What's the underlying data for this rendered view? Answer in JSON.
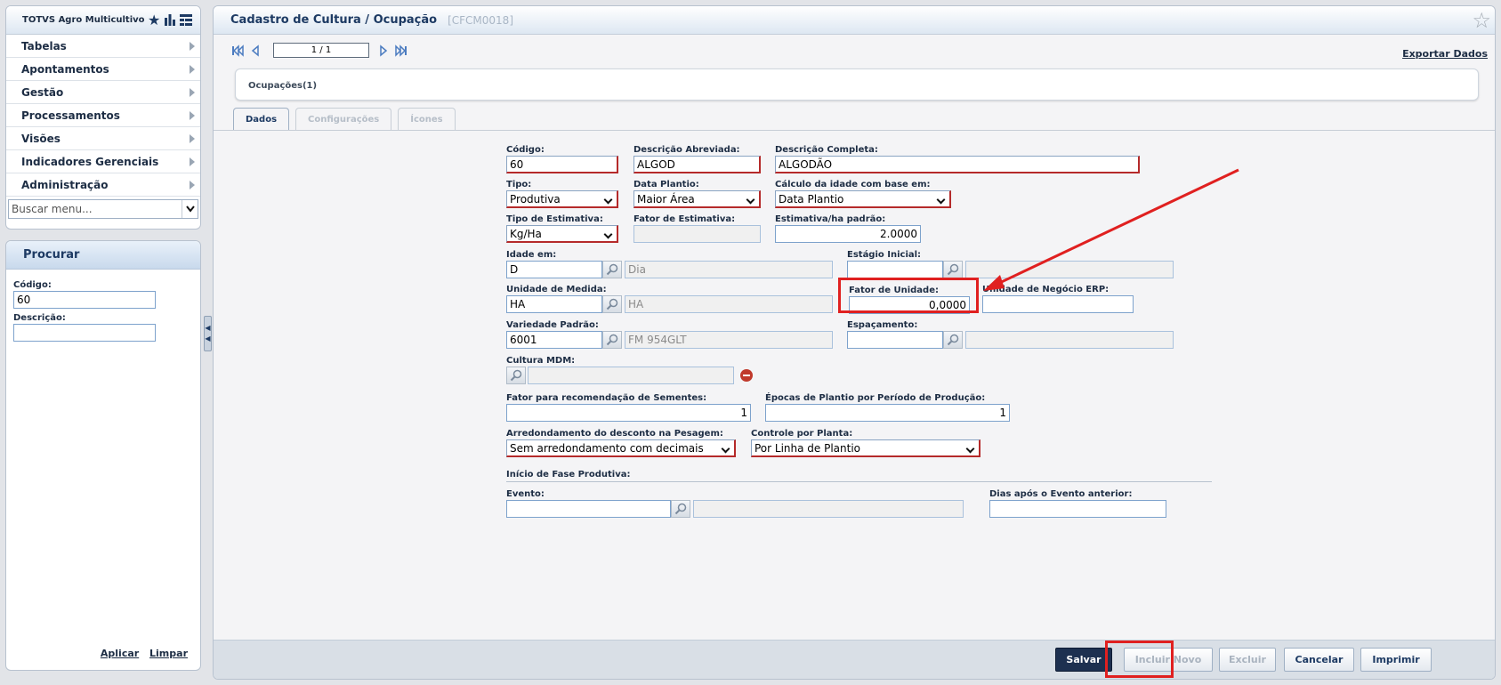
{
  "sidebar": {
    "app_title": "TOTVS Agro Multicultivo",
    "header_icons": [
      "star-icon",
      "bar-chart-icon",
      "grid-list-icon"
    ],
    "menu_items": [
      {
        "label": "Tabelas"
      },
      {
        "label": "Apontamentos"
      },
      {
        "label": "Gestão"
      },
      {
        "label": "Processamentos"
      },
      {
        "label": "Visões"
      },
      {
        "label": "Indicadores Gerenciais"
      },
      {
        "label": "Administração"
      }
    ],
    "menu_search_placeholder": "Buscar menu...",
    "search_panel": {
      "title": "Procurar",
      "codigo_label": "Código:",
      "codigo_value": "60",
      "descricao_label": "Descrição:",
      "descricao_value": "",
      "apply_label": "Aplicar",
      "clear_label": "Limpar"
    }
  },
  "header": {
    "title": "Cadastro de Cultura / Ocupação",
    "code": "[CFCM0018]"
  },
  "navigation": {
    "page_indicator": "1 / 1",
    "export_label": "Exportar Dados"
  },
  "occupations_label": "Ocupações(1)",
  "tabs": [
    {
      "label": "Dados",
      "active": true
    },
    {
      "label": "Configurações",
      "active": false
    },
    {
      "label": "Ícones",
      "active": false
    }
  ],
  "form": {
    "codigo": {
      "label": "Código:",
      "value": "60"
    },
    "descricao_abreviada": {
      "label": "Descrição Abreviada:",
      "value": "ALGOD"
    },
    "descricao_completa": {
      "label": "Descrição Completa:",
      "value": "ALGODÃO"
    },
    "tipo": {
      "label": "Tipo:",
      "value": "Produtiva"
    },
    "data_plantio": {
      "label": "Data Plantio:",
      "value": "Maior Área"
    },
    "calculo_idade": {
      "label": "Cálculo da idade com base em:",
      "value": "Data Plantio"
    },
    "tipo_estimativa": {
      "label": "Tipo de Estimativa:",
      "value": "Kg/Ha"
    },
    "fator_estimativa": {
      "label": "Fator de Estimativa:",
      "value": ""
    },
    "estimativa_ha": {
      "label": "Estimativa/ha padrão:",
      "value": "2.0000"
    },
    "idade_em": {
      "label": "Idade em:",
      "value": "D",
      "desc": "Dia"
    },
    "estagio_inicial": {
      "label": "Estágio Inicial:",
      "value": "",
      "desc": ""
    },
    "unidade_medida": {
      "label": "Unidade de Medida:",
      "value": "HA",
      "desc": "HA"
    },
    "fator_unidade": {
      "label": "Fator de Unidade:",
      "value": "0,0000"
    },
    "unidade_negocio": {
      "label": "Unidade de Negócio ERP:",
      "value": ""
    },
    "variedade_padrao": {
      "label": "Variedade Padrão:",
      "value": "6001",
      "desc": "FM 954GLT"
    },
    "espacamento": {
      "label": "Espaçamento:",
      "value": "",
      "desc": ""
    },
    "cultura_mdm": {
      "label": "Cultura MDM:",
      "desc": ""
    },
    "fator_sementes": {
      "label": "Fator para recomendação de Sementes:",
      "value": "1"
    },
    "epocas_plantio": {
      "label": "Épocas de Plantio por Período de Produção:",
      "value": "1"
    },
    "arredondamento": {
      "label": "Arredondamento do desconto na Pesagem:",
      "value": "Sem arredondamento com decimais"
    },
    "controle_planta": {
      "label": "Controle por Planta:",
      "value": "Por Linha de Plantio"
    },
    "inicio_fase_label": "Início de Fase Produtiva:",
    "evento": {
      "label": "Evento:",
      "value": "",
      "desc": ""
    },
    "dias_apos": {
      "label": "Dias após o Evento anterior:",
      "value": ""
    }
  },
  "footer": {
    "save": "Salvar",
    "new": "Incluir Novo",
    "delete": "Excluir",
    "cancel": "Cancelar",
    "print": "Imprimir"
  },
  "colors": {
    "highlight": "#e02020",
    "primary_button": "#1d3050",
    "required_border": "#b52a2a"
  }
}
